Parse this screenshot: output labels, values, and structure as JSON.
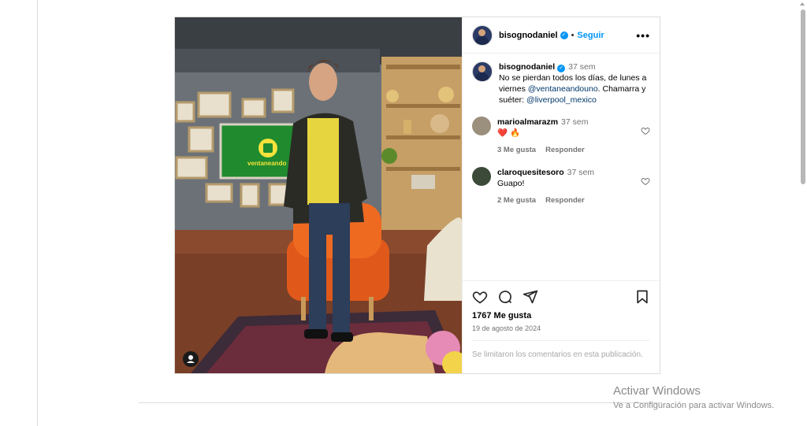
{
  "post": {
    "author": "bisognodaniel",
    "follow_label": "Seguir",
    "separator": "•",
    "caption": {
      "username": "bisognodaniel",
      "time": "37 sem",
      "text_before": "No se pierdan todos los días, de lunes a viernes ",
      "mention1": "@ventaneandouno",
      "text_middle": ". Chamarra y suéter: ",
      "mention2": "@liverpool_mexico"
    },
    "comments": [
      {
        "username": "marioalmarazm",
        "time": "37 sem",
        "text": "❤️ 🔥",
        "likes": "3 Me gusta",
        "reply": "Responder"
      },
      {
        "username": "claroquesitesoro",
        "time": "37 sem",
        "text": "Guapo!",
        "likes": "2 Me gusta",
        "reply": "Responder"
      }
    ],
    "likes_count": "1767 Me gusta",
    "date": "19 de agosto de 2024",
    "comments_limited": "Se limitaron los comentarios en esta publicación.",
    "studio_sign": "ventaneando"
  },
  "windows": {
    "title": "Activar Windows",
    "subtitle": "Ve a Configuración para activar Windows."
  },
  "colors": {
    "accent": "#0095f6",
    "muted": "#737373",
    "border": "#dbdbdb"
  },
  "icons": [
    "verified-badge-icon",
    "more-options-icon",
    "heart-icon",
    "comment-icon",
    "share-icon",
    "save-icon",
    "user-tag-icon"
  ]
}
